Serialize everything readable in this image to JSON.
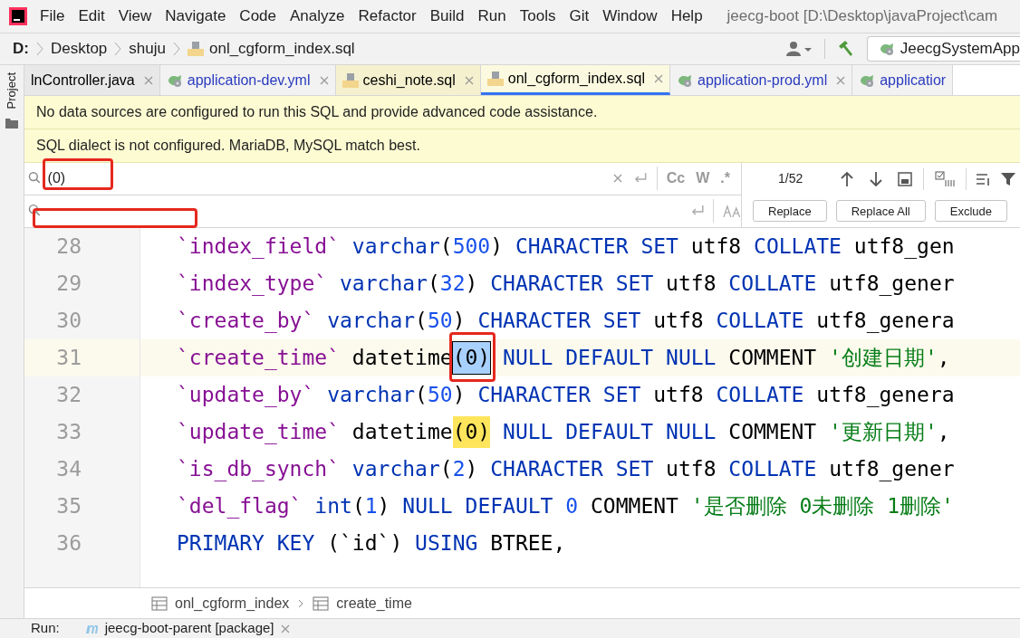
{
  "menu": {
    "items": [
      "File",
      "Edit",
      "View",
      "Navigate",
      "Code",
      "Analyze",
      "Refactor",
      "Build",
      "Run",
      "Tools",
      "Git",
      "Window",
      "Help"
    ],
    "title": "jeecg-boot [D:\\Desktop\\javaProject\\cam"
  },
  "nav": {
    "drive": "D:",
    "crumbs": [
      "Desktop",
      "shuju"
    ],
    "file": "onl_cgform_index.sql",
    "run_config": "JeecgSystemApp"
  },
  "side_panel": {
    "label": "Project"
  },
  "tabs": [
    {
      "label": "lnController.java",
      "kind": "plain",
      "selected": false,
      "color": "#e8e8e8"
    },
    {
      "label": "application-dev.yml",
      "kind": "yml",
      "selected": false,
      "color": "#f2f2f2"
    },
    {
      "label": "ceshi_note.sql",
      "kind": "sql",
      "selected": false,
      "color": "#f5f1cf"
    },
    {
      "label": "onl_cgform_index.sql",
      "kind": "sql",
      "selected": true,
      "color": "#fbf9df"
    },
    {
      "label": "application-prod.yml",
      "kind": "yml",
      "selected": false,
      "color": "#f2f2f2"
    },
    {
      "label": "applicatior",
      "kind": "yml",
      "selected": false,
      "color": "#f2f2f2"
    }
  ],
  "banners": [
    "No data sources are configured to run this SQL and provide advanced code assistance.",
    "SQL dialect is not configured. MariaDB, MySQL match best."
  ],
  "find": {
    "search": {
      "value": "(0)",
      "annotated": true
    },
    "options": [
      "Cc",
      "W",
      ".*"
    ],
    "count": "1/52"
  },
  "replace": {
    "annotated": true,
    "buttons": [
      "Replace",
      "Replace All",
      "Exclude"
    ]
  },
  "code": [
    {
      "number": "28",
      "current": false,
      "tokens": [
        {
          "text": "`index_field`",
          "kind": "field"
        },
        {
          "text": " varchar",
          "kind": "kw"
        },
        {
          "text": "(",
          "kind": "plain"
        },
        {
          "text": "500",
          "kind": "num"
        },
        {
          "text": ")",
          "kind": "plain"
        },
        {
          "text": " CHARACTER SET",
          "kind": "kw"
        },
        {
          "text": " utf8",
          "kind": "plain"
        },
        {
          "text": " COLLATE",
          "kind": "kw"
        },
        {
          "text": " utf8_gen",
          "kind": "plain"
        }
      ]
    },
    {
      "number": "29",
      "current": false,
      "tokens": [
        {
          "text": "`index_type`",
          "kind": "field"
        },
        {
          "text": " varchar",
          "kind": "kw"
        },
        {
          "text": "(",
          "kind": "plain"
        },
        {
          "text": "32",
          "kind": "num"
        },
        {
          "text": ")",
          "kind": "plain"
        },
        {
          "text": " CHARACTER SET",
          "kind": "kw"
        },
        {
          "text": " utf8",
          "kind": "plain"
        },
        {
          "text": " COLLATE",
          "kind": "kw"
        },
        {
          "text": " utf8_gener",
          "kind": "plain"
        }
      ]
    },
    {
      "number": "30",
      "current": false,
      "tokens": [
        {
          "text": "`create_by`",
          "kind": "field"
        },
        {
          "text": " varchar",
          "kind": "kw"
        },
        {
          "text": "(",
          "kind": "plain"
        },
        {
          "text": "50",
          "kind": "num"
        },
        {
          "text": ")",
          "kind": "plain"
        },
        {
          "text": " CHARACTER SET",
          "kind": "kw"
        },
        {
          "text": " utf8",
          "kind": "plain"
        },
        {
          "text": " COLLATE",
          "kind": "kw"
        },
        {
          "text": " utf8_genera",
          "kind": "plain"
        }
      ]
    },
    {
      "number": "31",
      "current": true,
      "tokens": [
        {
          "text": "`create_time`",
          "kind": "field"
        },
        {
          "text": " datetime",
          "kind": "plain"
        },
        {
          "text": "(0)",
          "kind": "match-current"
        },
        {
          "text": " NULL DEFAULT NULL",
          "kind": "kw"
        },
        {
          "text": " COMMENT",
          "kind": "plain"
        },
        {
          "text": " '创建日期'",
          "kind": "str"
        },
        {
          "text": ",",
          "kind": "plain"
        }
      ]
    },
    {
      "number": "32",
      "current": false,
      "tokens": [
        {
          "text": "`update_by`",
          "kind": "field"
        },
        {
          "text": " varchar",
          "kind": "kw"
        },
        {
          "text": "(",
          "kind": "plain"
        },
        {
          "text": "50",
          "kind": "num"
        },
        {
          "text": ")",
          "kind": "plain"
        },
        {
          "text": " CHARACTER SET",
          "kind": "kw"
        },
        {
          "text": " utf8",
          "kind": "plain"
        },
        {
          "text": " COLLATE",
          "kind": "kw"
        },
        {
          "text": " utf8_genera",
          "kind": "plain"
        }
      ]
    },
    {
      "number": "33",
      "current": false,
      "tokens": [
        {
          "text": "`update_time`",
          "kind": "field"
        },
        {
          "text": " datetime",
          "kind": "plain"
        },
        {
          "text": "(0)",
          "kind": "match"
        },
        {
          "text": " NULL DEFAULT NULL",
          "kind": "kw"
        },
        {
          "text": " COMMENT",
          "kind": "plain"
        },
        {
          "text": " '更新日期'",
          "kind": "str"
        },
        {
          "text": ",",
          "kind": "plain"
        }
      ]
    },
    {
      "number": "34",
      "current": false,
      "tokens": [
        {
          "text": "`is_db_synch`",
          "kind": "field"
        },
        {
          "text": " varchar",
          "kind": "kw"
        },
        {
          "text": "(",
          "kind": "plain"
        },
        {
          "text": "2",
          "kind": "num"
        },
        {
          "text": ")",
          "kind": "plain"
        },
        {
          "text": " CHARACTER SET",
          "kind": "kw"
        },
        {
          "text": " utf8",
          "kind": "plain"
        },
        {
          "text": " COLLATE",
          "kind": "kw"
        },
        {
          "text": " utf8_gener",
          "kind": "plain"
        }
      ]
    },
    {
      "number": "35",
      "current": false,
      "tokens": [
        {
          "text": "`del_flag`",
          "kind": "field"
        },
        {
          "text": " int",
          "kind": "kw"
        },
        {
          "text": "(",
          "kind": "plain"
        },
        {
          "text": "1",
          "kind": "num"
        },
        {
          "text": ")",
          "kind": "plain"
        },
        {
          "text": " NULL DEFAULT",
          "kind": "kw"
        },
        {
          "text": " 0",
          "kind": "num"
        },
        {
          "text": " COMMENT",
          "kind": "plain"
        },
        {
          "text": " '是否删除 0未删除 1删除'",
          "kind": "str"
        }
      ]
    },
    {
      "number": "36",
      "current": false,
      "tokens": [
        {
          "text": "PRIMARY KEY",
          "kind": "kw"
        },
        {
          "text": " (`id`)",
          "kind": "plain"
        },
        {
          "text": " USING",
          "kind": "kw"
        },
        {
          "text": " BTREE,",
          "kind": "plain"
        }
      ]
    }
  ],
  "breadcrumb": [
    "onl_cgform_index",
    "create_time"
  ],
  "run_bar": {
    "label": "Run:",
    "config": "jeecg-boot-parent [package]"
  }
}
